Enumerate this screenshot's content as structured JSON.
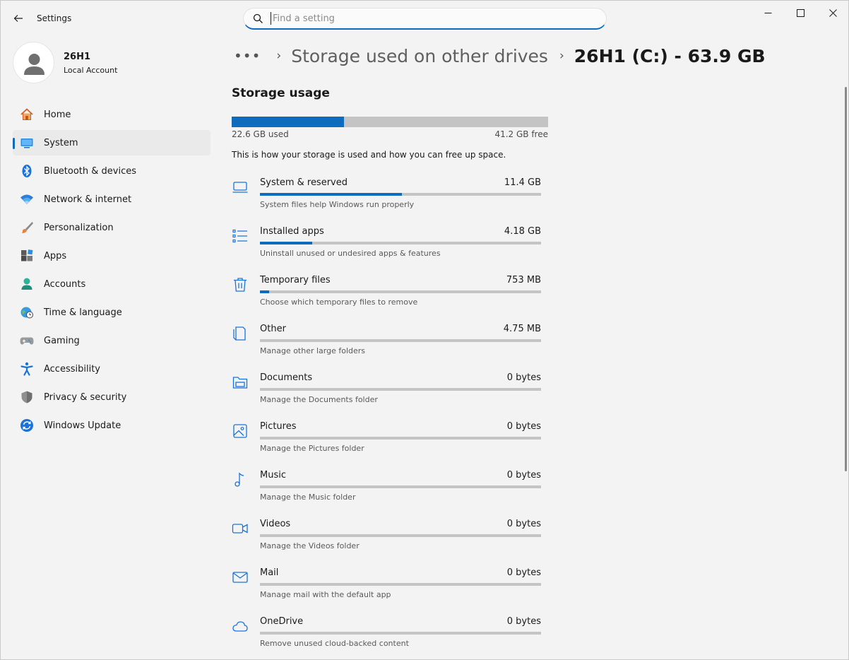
{
  "window": {
    "title": "Settings",
    "search_placeholder": "Find a setting"
  },
  "profile": {
    "name": "26H1",
    "account_type": "Local Account"
  },
  "nav": [
    {
      "label": "Home",
      "icon": "home-icon",
      "selected": false
    },
    {
      "label": "System",
      "icon": "system-icon",
      "selected": true
    },
    {
      "label": "Bluetooth & devices",
      "icon": "bluetooth-icon",
      "selected": false
    },
    {
      "label": "Network & internet",
      "icon": "wifi-icon",
      "selected": false
    },
    {
      "label": "Personalization",
      "icon": "brush-icon",
      "selected": false
    },
    {
      "label": "Apps",
      "icon": "apps-icon",
      "selected": false
    },
    {
      "label": "Accounts",
      "icon": "accounts-icon",
      "selected": false
    },
    {
      "label": "Time & language",
      "icon": "globe-clock-icon",
      "selected": false
    },
    {
      "label": "Gaming",
      "icon": "gamepad-icon",
      "selected": false
    },
    {
      "label": "Accessibility",
      "icon": "accessibility-icon",
      "selected": false
    },
    {
      "label": "Privacy & security",
      "icon": "shield-icon",
      "selected": false
    },
    {
      "label": "Windows Update",
      "icon": "update-icon",
      "selected": false
    }
  ],
  "breadcrumb": {
    "more": "•••",
    "parent": "Storage used on other drives",
    "current": "26H1 (C:) - 63.9 GB"
  },
  "storage": {
    "title": "Storage usage",
    "used_label": "22.6 GB used",
    "free_label": "41.2 GB free",
    "used_fraction": 0.354,
    "description": "This is how your storage is used and how you can free up space.",
    "categories": [
      {
        "name": "System & reserved",
        "size": "11.4 GB",
        "subtitle": "System files help Windows run properly",
        "fraction": 0.505,
        "icon": "laptop-icon"
      },
      {
        "name": "Installed apps",
        "size": "4.18 GB",
        "subtitle": "Uninstall unused or undesired apps & features",
        "fraction": 0.185,
        "icon": "list-icon"
      },
      {
        "name": "Temporary files",
        "size": "753 MB",
        "subtitle": "Choose which temporary files to remove",
        "fraction": 0.033,
        "icon": "trash-icon"
      },
      {
        "name": "Other",
        "size": "4.75 MB",
        "subtitle": "Manage other large folders",
        "fraction": 0.0,
        "icon": "document-icon"
      },
      {
        "name": "Documents",
        "size": "0 bytes",
        "subtitle": "Manage the Documents folder",
        "fraction": 0.0,
        "icon": "folder-icon"
      },
      {
        "name": "Pictures",
        "size": "0 bytes",
        "subtitle": "Manage the Pictures folder",
        "fraction": 0.0,
        "icon": "picture-icon"
      },
      {
        "name": "Music",
        "size": "0 bytes",
        "subtitle": "Manage the Music folder",
        "fraction": 0.0,
        "icon": "music-icon"
      },
      {
        "name": "Videos",
        "size": "0 bytes",
        "subtitle": "Manage the Videos folder",
        "fraction": 0.0,
        "icon": "video-icon"
      },
      {
        "name": "Mail",
        "size": "0 bytes",
        "subtitle": "Manage mail with the default app",
        "fraction": 0.0,
        "icon": "mail-icon"
      },
      {
        "name": "OneDrive",
        "size": "0 bytes",
        "subtitle": "Remove unused cloud-backed content",
        "fraction": 0.0,
        "icon": "cloud-icon"
      }
    ]
  },
  "colors": {
    "accent": "#0f6cbd",
    "bar_track": "#c4c4c4",
    "background": "#f3f3f3"
  }
}
